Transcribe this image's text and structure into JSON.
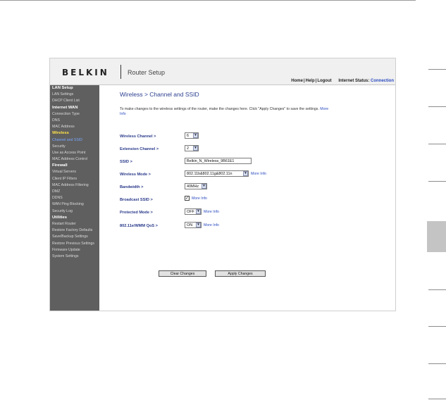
{
  "brand": {
    "logo": "BELKIN",
    "app_title": "Router Setup"
  },
  "top_links": {
    "home": "Home",
    "help": "Help",
    "logout": "Logout",
    "separator": "|",
    "status_label": "Internet Status:",
    "status_value": "Connection"
  },
  "sidebar": {
    "items": [
      {
        "label": "LAN Setup",
        "kind": "section"
      },
      {
        "label": "LAN Settings",
        "kind": "link"
      },
      {
        "label": "DHCP Client List",
        "kind": "link"
      },
      {
        "label": "Internet WAN",
        "kind": "section"
      },
      {
        "label": "Connection Type",
        "kind": "link"
      },
      {
        "label": "DNS",
        "kind": "link"
      },
      {
        "label": "MAC Address",
        "kind": "link"
      },
      {
        "label": "Wireless",
        "kind": "active-section"
      },
      {
        "label": "Channel and SSID",
        "kind": "current"
      },
      {
        "label": "Security",
        "kind": "link"
      },
      {
        "label": "Use as Access Point",
        "kind": "link"
      },
      {
        "label": "MAC Address Control",
        "kind": "link"
      },
      {
        "label": "Firewall",
        "kind": "section"
      },
      {
        "label": "Virtual Servers",
        "kind": "link"
      },
      {
        "label": "Client IP Filters",
        "kind": "link"
      },
      {
        "label": "MAC Address Filtering",
        "kind": "link"
      },
      {
        "label": "DMZ",
        "kind": "link"
      },
      {
        "label": "DDNS",
        "kind": "link"
      },
      {
        "label": "WAN Ping Blocking",
        "kind": "link"
      },
      {
        "label": "Security Log",
        "kind": "link"
      },
      {
        "label": "Utilities",
        "kind": "section"
      },
      {
        "label": "Restart Router",
        "kind": "link"
      },
      {
        "label": "Restore Factory Defaults",
        "kind": "link"
      },
      {
        "label": "Save/Backup Settings",
        "kind": "link"
      },
      {
        "label": "Restore Previous Settings",
        "kind": "link"
      },
      {
        "label": "Firmware Update",
        "kind": "link"
      },
      {
        "label": "System Settings",
        "kind": "link"
      }
    ]
  },
  "main": {
    "title": "Wireless > Channel and SSID",
    "intro": "To make changes to the wireless settings of the router, make the changes here. Click \"Apply Changes\" to save the settings.",
    "intro_link": "More Info",
    "fields": {
      "wireless_channel": {
        "label": "Wireless Channel >",
        "value": "6"
      },
      "extension_channel": {
        "label": "Extension Channel >",
        "value": "2"
      },
      "ssid": {
        "label": "SSID >",
        "value": "Belkin_N_Wireless_9B61E1"
      },
      "wireless_mode": {
        "label": "Wireless Mode >",
        "value": "802.11b&802.11g&802.11n",
        "more": "More Info"
      },
      "bandwidth": {
        "label": "Bandwidth >",
        "value": "40MHz"
      },
      "broadcast_ssid": {
        "label": "Broadcast SSID >",
        "checked": true,
        "more": "More Info"
      },
      "protected_mode": {
        "label": "Protected Mode >",
        "value": "OFF",
        "more": "More Info"
      },
      "wmm_qos": {
        "label": "802.11e/WMM QoS >",
        "value": "ON",
        "more": "More Info"
      }
    },
    "buttons": {
      "clear": "Clear Changes",
      "apply": "Apply Changes"
    }
  },
  "icons": {
    "select_arrow": "chevron-down-icon",
    "checkmark": "check-icon"
  }
}
